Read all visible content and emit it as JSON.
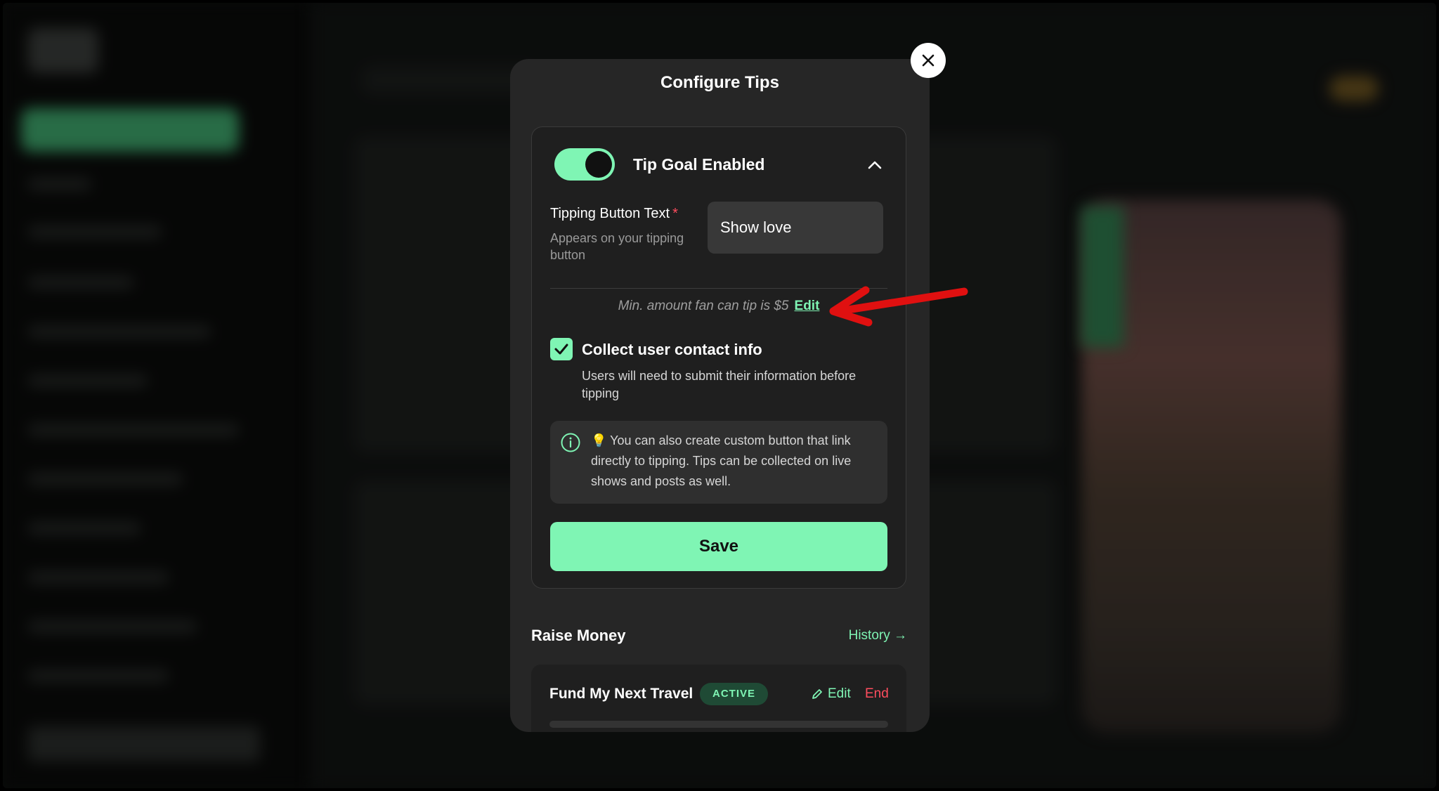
{
  "modal": {
    "title": "Configure Tips",
    "toggle_label": "Tip Goal Enabled",
    "toggle_on": true,
    "button_text_label": "Tipping Button Text",
    "required_mark": "*",
    "button_text_help": "Appears on your tipping button",
    "button_text_value": "Show love",
    "min_amount_text": "Min. amount fan can tip is $5",
    "min_amount_edit": "Edit",
    "collect_label": "Collect user contact info",
    "collect_checked": true,
    "collect_help": "Users will need to submit their information before tipping",
    "info_text": "💡 You can also create custom button that link directly to tipping. Tips can be collected on live shows and posts as well.",
    "save_label": "Save"
  },
  "raise_money": {
    "title": "Raise Money",
    "history_label": "History →",
    "fund": {
      "title": "Fund My Next Travel",
      "status": "ACTIVE",
      "edit_label": "Edit",
      "end_label": "End"
    }
  },
  "colors": {
    "accent": "#7ff5b4",
    "danger": "#ff4d5e",
    "modal_bg": "#262626",
    "annotation_arrow": "#e01010"
  },
  "icons": {
    "close": "close-icon",
    "chevron": "chevron-up-icon",
    "check": "checkmark-icon",
    "info": "info-icon",
    "pencil": "pencil-icon"
  }
}
